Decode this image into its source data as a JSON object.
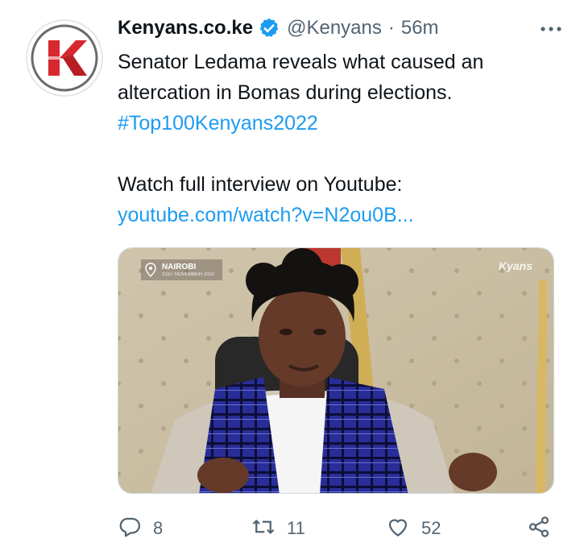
{
  "account": {
    "display_name": "Kenyans.co.ke",
    "handle": "@Kenyans",
    "separator": "·",
    "time": "56m",
    "verified": true,
    "avatar_letter": "K"
  },
  "tweet": {
    "line1": "Senator Ledama reveals what caused an",
    "line2": "altercation in Bomas during elections.",
    "hashtag": "#Top100Kenyans2022",
    "line4": "Watch full interview on Youtube:",
    "link": "youtube.com/watch?v=N2ou0B..."
  },
  "media": {
    "location_city": "NAIROBI",
    "location_date": "21ST NOVEMBER 2022",
    "watermark": "Kyans"
  },
  "actions": {
    "reply_count": "8",
    "retweet_count": "11",
    "like_count": "52"
  },
  "colors": {
    "link": "#1d9bf0",
    "muted": "#536471",
    "brand_red": "#d7282f"
  }
}
